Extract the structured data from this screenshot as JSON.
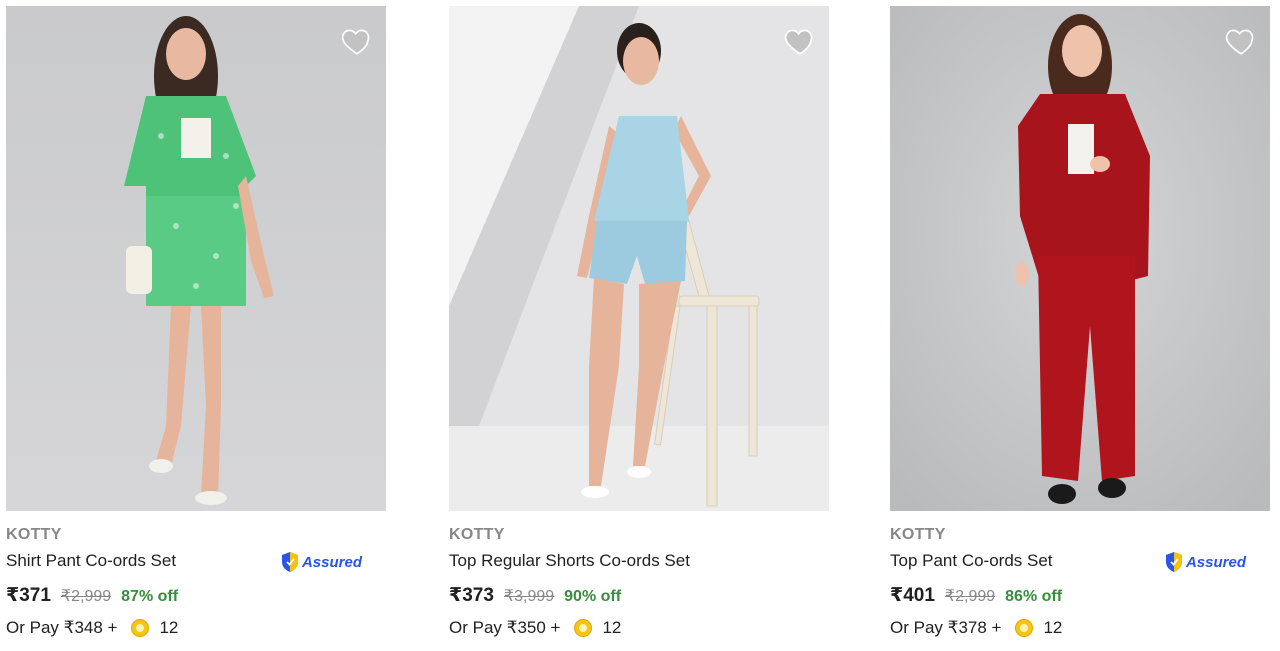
{
  "products": [
    {
      "brand": "KOTTY",
      "title": "Shirt Pant Co-ords Set",
      "price": "₹371",
      "mrp": "₹2,999",
      "discount": "87% off",
      "pay_prefix": "Or Pay ₹348 +",
      "coins": "12",
      "assured": true,
      "assured_label": "Assured",
      "image_icon": "product-photo-green-coords"
    },
    {
      "brand": "KOTTY",
      "title": "Top Regular Shorts Co-ords Set",
      "price": "₹373",
      "mrp": "₹3,999",
      "discount": "90% off",
      "pay_prefix": "Or Pay ₹350 +",
      "coins": "12",
      "assured": false,
      "image_icon": "product-photo-blue-coords"
    },
    {
      "brand": "KOTTY",
      "title": "Top Pant Co-ords Set",
      "price": "₹401",
      "mrp": "₹2,999",
      "discount": "86% off",
      "pay_prefix": "Or Pay ₹378 +",
      "coins": "12",
      "assured": true,
      "assured_label": "Assured",
      "image_icon": "product-photo-red-coords"
    }
  ],
  "colors": {
    "discount": "#388e3c",
    "mrp": "#878787",
    "assured": "#2a55e5",
    "wishlist": "#c2c2c2"
  }
}
